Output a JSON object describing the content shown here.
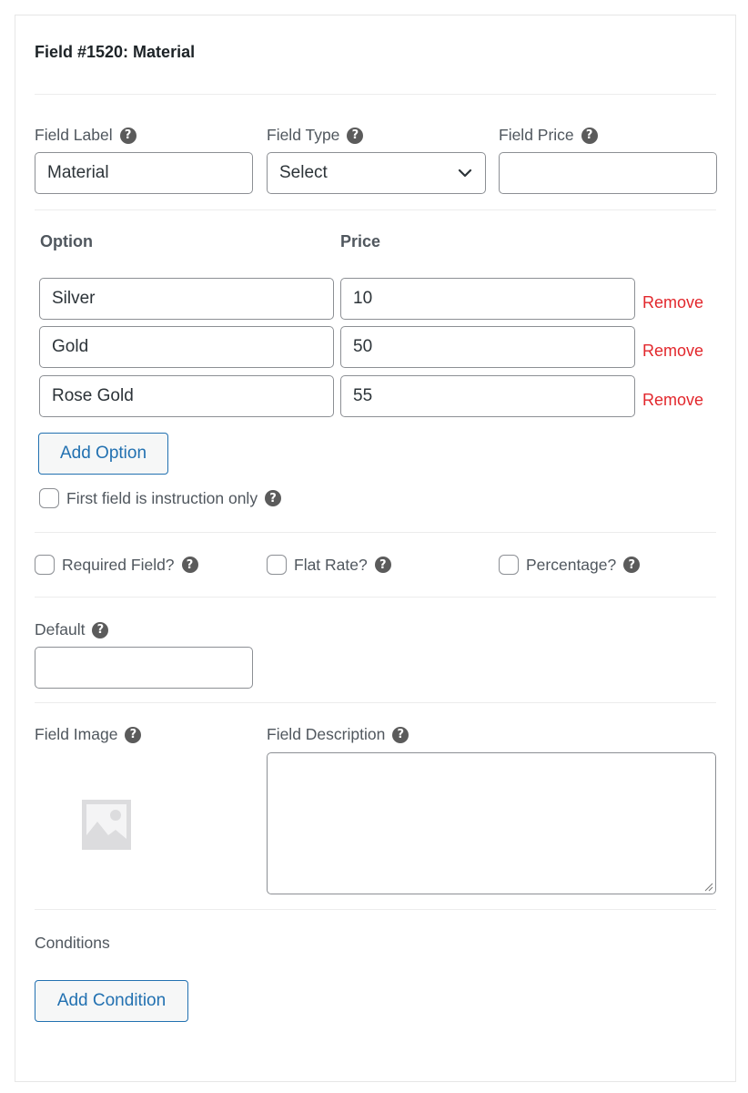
{
  "header": {
    "title": "Field #1520: Material"
  },
  "fields": {
    "field_label": {
      "label": "Field Label",
      "value": "Material"
    },
    "field_type": {
      "label": "Field Type",
      "value": "Select"
    },
    "field_price": {
      "label": "Field Price",
      "value": ""
    }
  },
  "options": {
    "col_option": "Option",
    "col_price": "Price",
    "rows": [
      {
        "option": "Silver",
        "price": "10",
        "remove_label": "Remove"
      },
      {
        "option": "Gold",
        "price": "50",
        "remove_label": "Remove"
      },
      {
        "option": "Rose Gold",
        "price": "55",
        "remove_label": "Remove"
      }
    ],
    "add_label": "Add Option",
    "instruction_only": {
      "label": "First field is instruction only",
      "checked": false
    }
  },
  "flags": {
    "required": {
      "label": "Required Field?",
      "checked": false
    },
    "flat_rate": {
      "label": "Flat Rate?",
      "checked": false
    },
    "percentage": {
      "label": "Percentage?",
      "checked": false
    }
  },
  "default": {
    "label": "Default",
    "value": ""
  },
  "image": {
    "label": "Field Image",
    "icon": "image-placeholder-icon"
  },
  "description": {
    "label": "Field Description",
    "value": ""
  },
  "conditions": {
    "label": "Conditions",
    "add_label": "Add Condition"
  },
  "icons": {
    "help": "?"
  },
  "colors": {
    "accent": "#2271b1",
    "danger": "#e2272c",
    "text": "#50575e"
  }
}
